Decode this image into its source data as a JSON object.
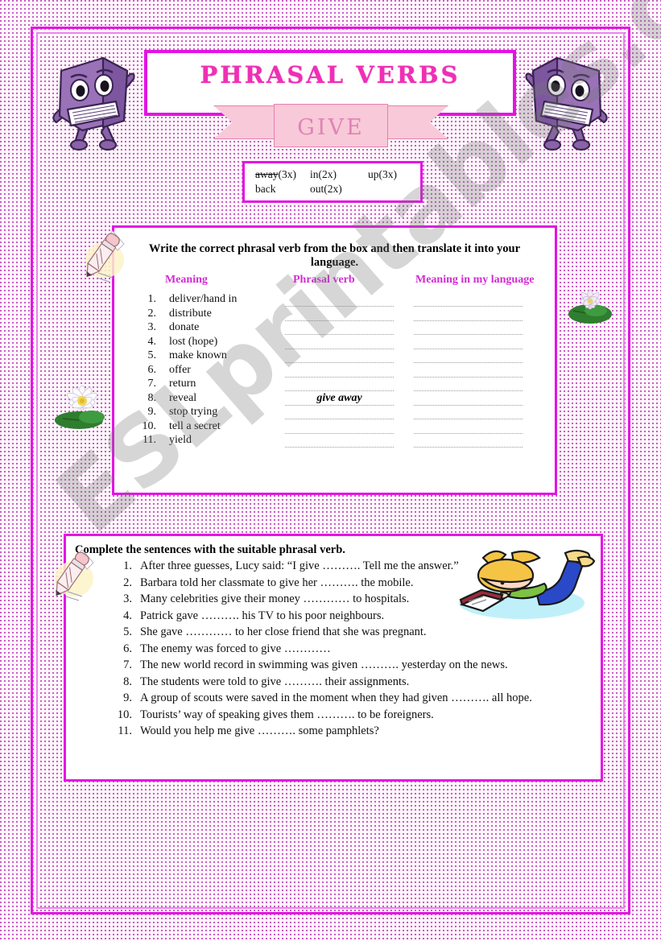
{
  "header": {
    "title": "PHRASAL  VERBS",
    "banner_label": "GIVE"
  },
  "word_box": {
    "rows": [
      {
        "c1": "away",
        "c1_count": "(3x)",
        "c1_struck": true,
        "c2": "in(2x)",
        "c3": "up(3x)"
      },
      {
        "c1": "back",
        "c1_count": "",
        "c1_struck": false,
        "c2": "out(2x)",
        "c3": ""
      }
    ]
  },
  "exercise1": {
    "instruction": "Write the correct phrasal verb from the box and then translate it into your language.",
    "columns": {
      "meaning": "Meaning",
      "phrasal_verb": "Phrasal verb",
      "my_language": "Meaning in my language"
    },
    "rows": [
      {
        "num": "1.",
        "meaning": "deliver/hand in",
        "answer": ""
      },
      {
        "num": "2.",
        "meaning": "distribute",
        "answer": ""
      },
      {
        "num": "3.",
        "meaning": "donate",
        "answer": ""
      },
      {
        "num": "4.",
        "meaning": "lost (hope)",
        "answer": ""
      },
      {
        "num": "5.",
        "meaning": "make known",
        "answer": ""
      },
      {
        "num": "6.",
        "meaning": "offer",
        "answer": ""
      },
      {
        "num": "7.",
        "meaning": "return",
        "answer": ""
      },
      {
        "num": "8.",
        "meaning": "reveal",
        "answer": "give away"
      },
      {
        "num": "9.",
        "meaning": "stop trying",
        "answer": ""
      },
      {
        "num": "10.",
        "meaning": "tell a secret",
        "answer": ""
      },
      {
        "num": "11.",
        "meaning": "yield",
        "answer": ""
      }
    ]
  },
  "exercise2": {
    "instruction": "Complete the sentences with the suitable phrasal verb.",
    "rows": [
      {
        "num": "1.",
        "text": "After three guesses, Lucy said: “I give ………. Tell me the answer.”"
      },
      {
        "num": "2.",
        "text": "Barbara told her classmate to give her ………. the mobile."
      },
      {
        "num": "3.",
        "text": "Many celebrities give their money ………… to hospitals."
      },
      {
        "num": "4.",
        "text": "Patrick gave ………. his TV to his poor neighbours."
      },
      {
        "num": "5.",
        "text": "She gave ………… to her close friend that she was pregnant."
      },
      {
        "num": "6.",
        "text": "The enemy was forced to give …………"
      },
      {
        "num": "7.",
        "text": "The new world record in swimming was given ………. yesterday on the news."
      },
      {
        "num": "8.",
        "text": "The students were told to give ………. their assignments."
      },
      {
        "num": "9.",
        "text": "A group of scouts were saved in the moment when they had given ………. all hope."
      },
      {
        "num": "10.",
        "text": "Tourists’ way of speaking gives them ………. to be foreigners."
      },
      {
        "num": "11.",
        "text": "Would you help me give ………. some pamphlets?"
      }
    ]
  },
  "watermark": {
    "text": "ESLprintables.com"
  },
  "colors": {
    "frame_magenta": "#e313e3",
    "title_pink": "#ef2fb5",
    "heading_magenta": "#d42ad4",
    "ribbon_pink": "#f8c9d8",
    "book_purple": "#8a62a8"
  }
}
